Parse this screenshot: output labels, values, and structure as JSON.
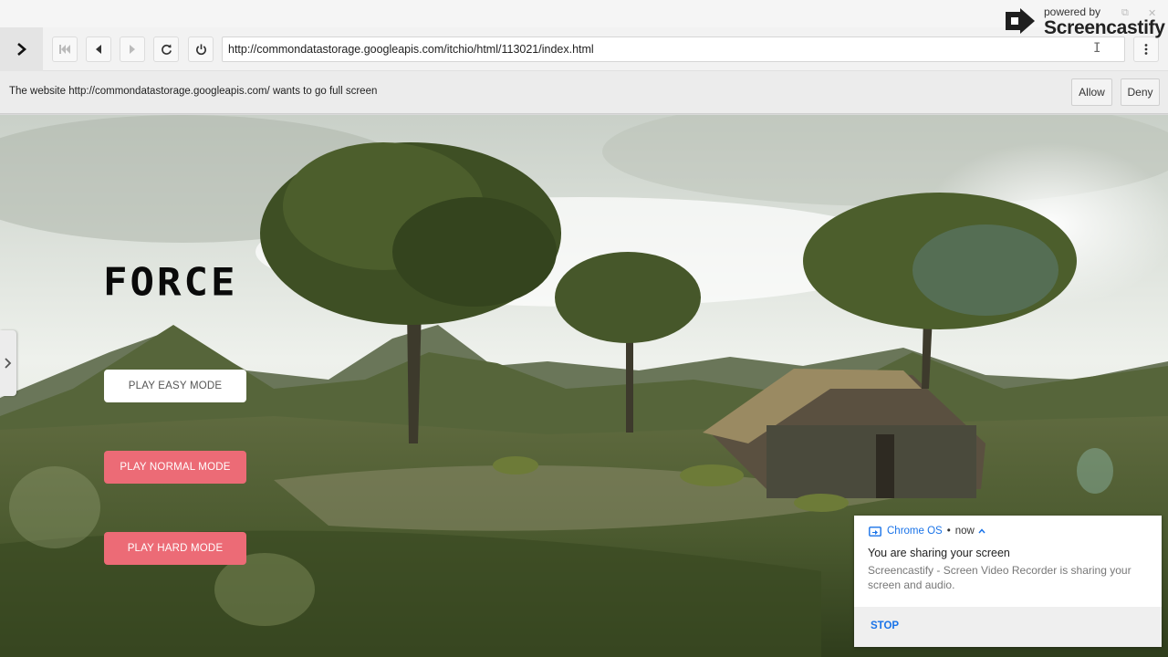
{
  "watermark": {
    "powered_by": "powered by",
    "brand": "Screencastify"
  },
  "toolbar": {
    "url": "http://commondatastorage.googleapis.com/itchio/html/113021/index.html",
    "icons": [
      "chevron-right-icon",
      "skip-start-icon",
      "back-icon",
      "forward-icon",
      "reload-icon",
      "power-icon",
      "more-vert-icon"
    ]
  },
  "fullscreen_prompt": {
    "message": "The website http://commondatastorage.googleapis.com/ wants to go full screen",
    "allow_label": "Allow",
    "deny_label": "Deny"
  },
  "game": {
    "title": "FORCE",
    "buttons": {
      "easy": "PLAY EASY MODE",
      "normal": "PLAY NORMAL MODE",
      "hard": "PLAY HARD MODE"
    },
    "colors": {
      "accent_button": "#ec6b76",
      "easy_button": "#ffffff"
    }
  },
  "notification": {
    "source": "Chrome OS",
    "separator": "•",
    "time": "now",
    "title": "You are sharing your screen",
    "body": "Screencastify - Screen Video Recorder is sharing your screen and audio.",
    "stop_label": "STOP",
    "accent_color": "#1a73e8"
  }
}
